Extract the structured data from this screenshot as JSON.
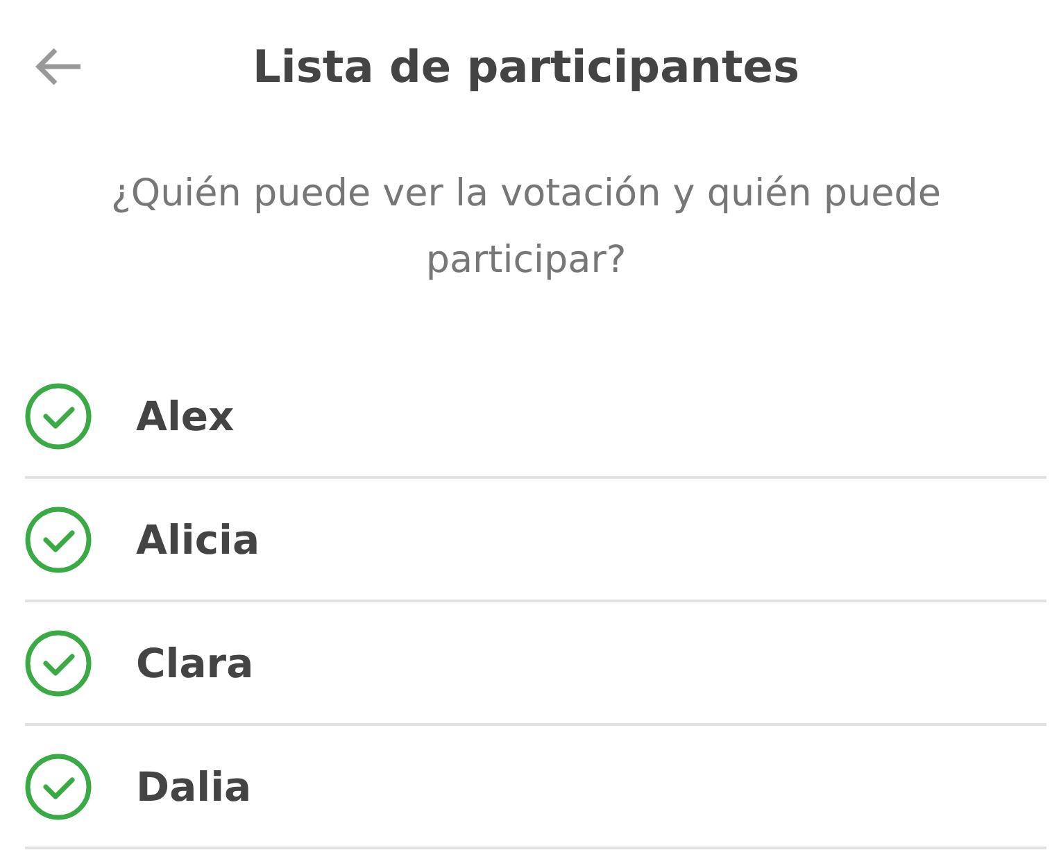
{
  "header": {
    "title": "Lista de participantes"
  },
  "question": "¿Quién puede ver la votación y quién puede participar?",
  "participants": [
    {
      "name": "Alex",
      "checked": true
    },
    {
      "name": "Alicia",
      "checked": true
    },
    {
      "name": "Clara",
      "checked": true
    },
    {
      "name": "Dalia",
      "checked": true
    }
  ]
}
